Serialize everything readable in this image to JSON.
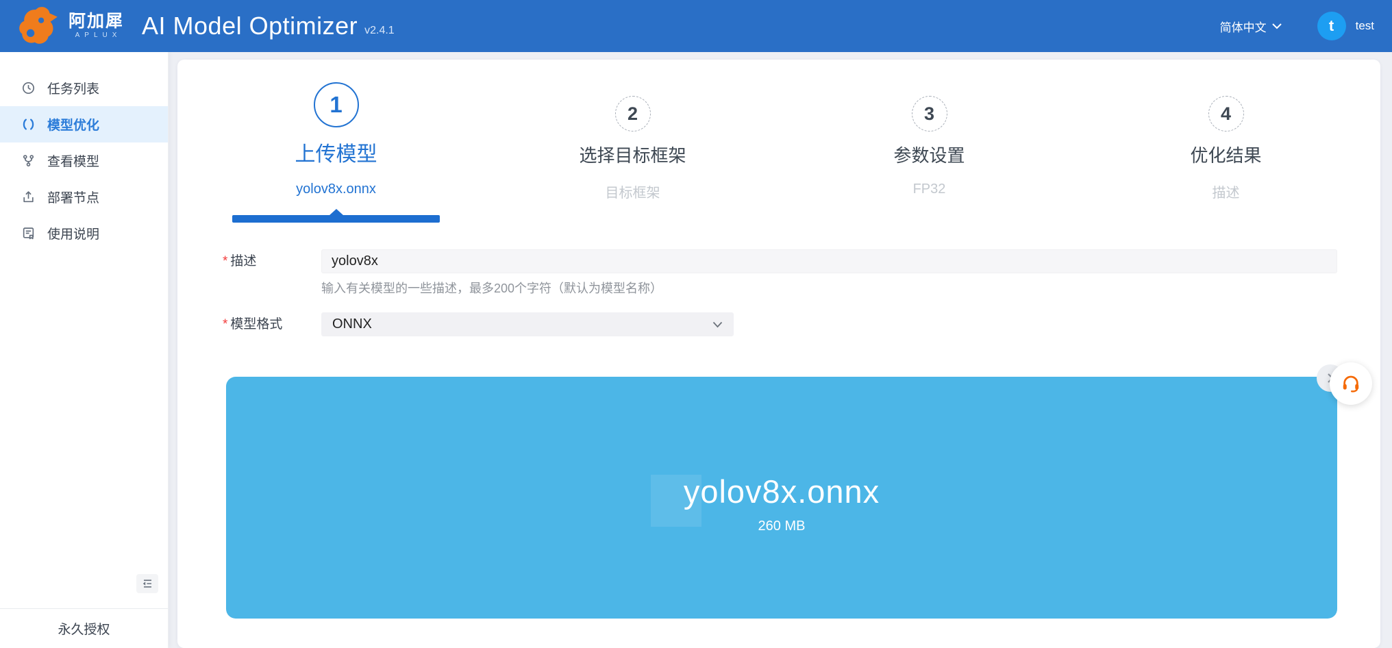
{
  "header": {
    "brand_cn": "阿加犀",
    "brand_en": "APLUX",
    "title": "AI Model Optimizer",
    "version": "v2.4.1",
    "language": "简体中文",
    "avatar_initial": "t",
    "username": "test"
  },
  "sidebar": {
    "items": [
      {
        "label": "任务列表",
        "icon": "history-icon",
        "active": false
      },
      {
        "label": "模型优化",
        "icon": "optimize-icon",
        "active": true
      },
      {
        "label": "查看模型",
        "icon": "model-branch-icon",
        "active": false
      },
      {
        "label": "部署节点",
        "icon": "deploy-icon",
        "active": false
      },
      {
        "label": "使用说明",
        "icon": "docs-icon",
        "active": false
      }
    ],
    "footer_label": "永久授权"
  },
  "stepper": {
    "steps": [
      {
        "number": "1",
        "title": "上传模型",
        "subtitle": "yolov8x.onnx",
        "state": "active"
      },
      {
        "number": "2",
        "title": "选择目标框架",
        "subtitle": "目标框架",
        "state": "pending"
      },
      {
        "number": "3",
        "title": "参数设置",
        "subtitle": "FP32",
        "state": "pending"
      },
      {
        "number": "4",
        "title": "优化结果",
        "subtitle": "描述",
        "state": "pending"
      }
    ]
  },
  "form": {
    "description": {
      "label": "描述",
      "required": true,
      "value": "yolov8x",
      "helper": "输入有关模型的一些描述，最多200个字符（默认为模型名称）"
    },
    "format": {
      "label": "模型格式",
      "required": true,
      "value": "ONNX"
    }
  },
  "upload": {
    "filename": "yolov8x.onnx",
    "filesize": "260 MB"
  },
  "colors": {
    "header_blue": "#2a6fc6",
    "avatar_blue": "#1d9ef2",
    "primary_blue": "#2273d2",
    "progress_blue": "#1d6ed0",
    "upload_blue": "#4cb6e7",
    "active_item_bg": "#e4f1fd",
    "logo_orange": "#f07c1c",
    "required_red": "#f23c3c"
  }
}
